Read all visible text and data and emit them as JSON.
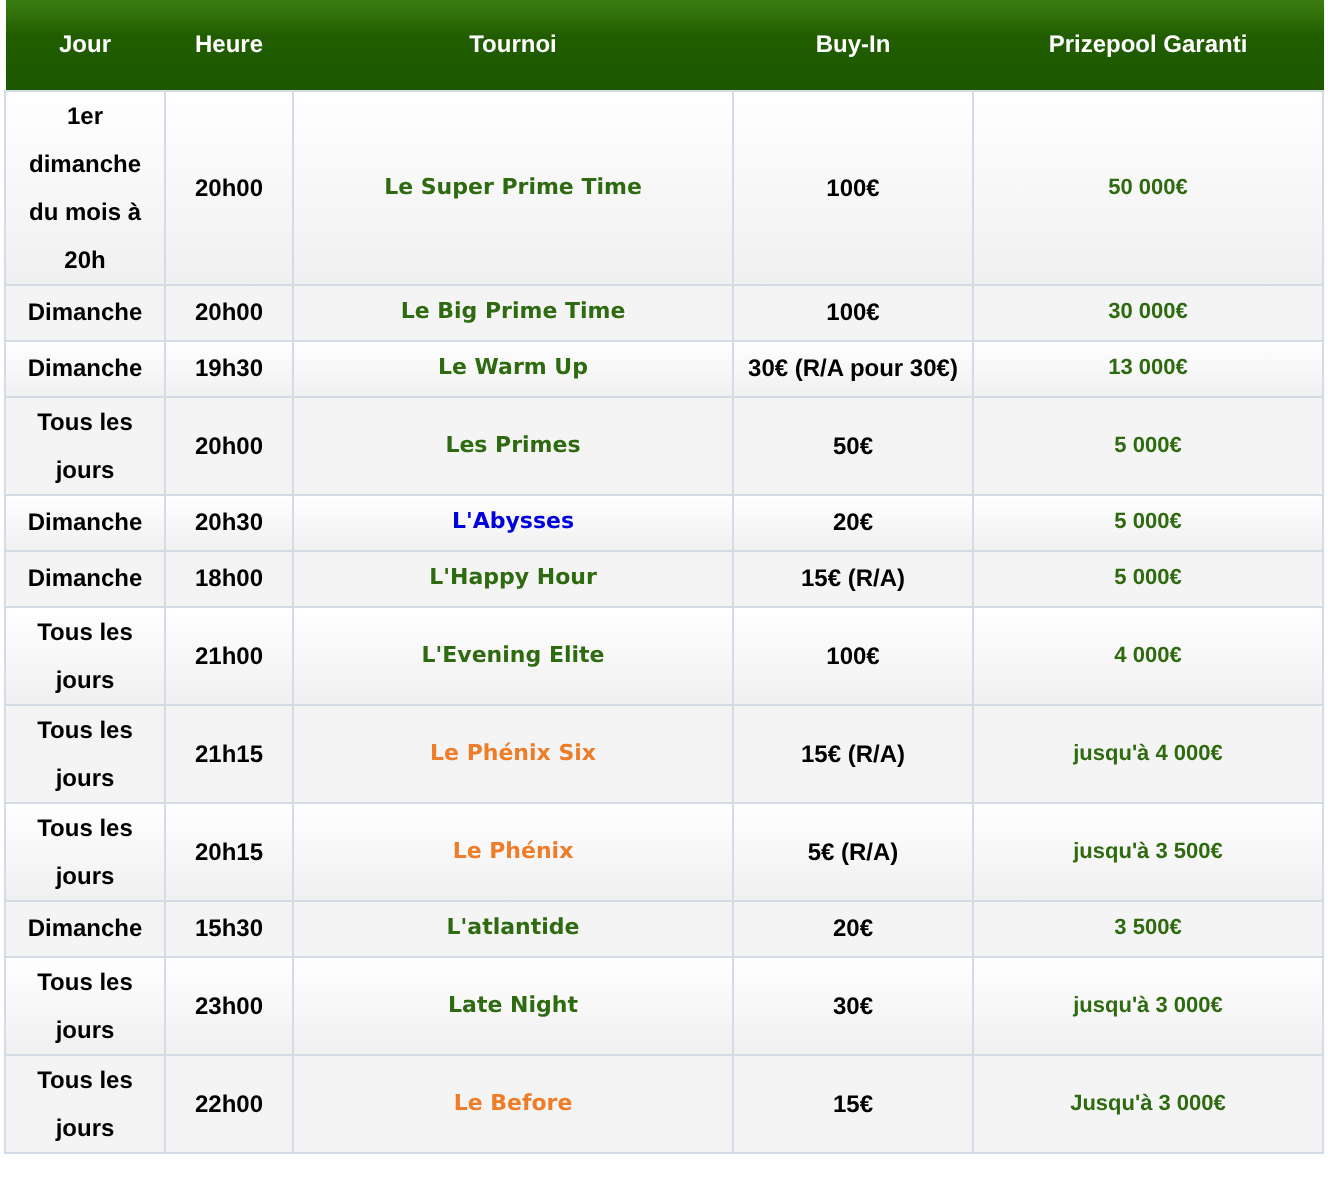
{
  "table": {
    "columns": [
      "Jour",
      "Heure",
      "Tournoi",
      "Buy-In",
      "Prizepool Garanti"
    ],
    "rows": [
      {
        "jour": "1er dimanche du mois à 20h",
        "heure": "20h00",
        "tournoi": "Le Super Prime Time",
        "color": "#2e6a0f",
        "buy_in": "100€",
        "prizepool": "50 000€"
      },
      {
        "jour": "Dimanche",
        "heure": "20h00",
        "tournoi": "Le Big Prime Time",
        "color": "#2e6a0f",
        "buy_in": "100€",
        "prizepool": "30 000€"
      },
      {
        "jour": "Dimanche",
        "heure": "19h30",
        "tournoi": "Le Warm Up",
        "color": "#2e6a0f",
        "buy_in": "30€ (R/A pour 30€)",
        "prizepool": "13 000€"
      },
      {
        "jour": "Tous les jours",
        "heure": "20h00",
        "tournoi": "Les Primes",
        "color": "#2e6a0f",
        "buy_in": "50€",
        "prizepool": "5 000€"
      },
      {
        "jour": "Dimanche",
        "heure": "20h30",
        "tournoi": "L'Abysses",
        "color": "#0000dd",
        "buy_in": "20€",
        "prizepool": "5 000€"
      },
      {
        "jour": "Dimanche",
        "heure": "18h00",
        "tournoi": "L'Happy Hour",
        "color": "#2e6a0f",
        "buy_in": "15€ (R/A)",
        "prizepool": "5 000€"
      },
      {
        "jour": "Tous les jours",
        "heure": "21h00",
        "tournoi": "L'Evening Elite",
        "color": "#2e6a0f",
        "buy_in": "100€",
        "prizepool": "4 000€"
      },
      {
        "jour": "Tous les jours",
        "heure": "21h15",
        "tournoi": "Le Phénix Six",
        "color": "#ee7d2a",
        "buy_in": "15€ (R/A)",
        "prizepool": "jusqu'à 4 000€"
      },
      {
        "jour": "Tous les jours",
        "heure": "20h15",
        "tournoi": "Le Phénix",
        "color": "#ee7d2a",
        "buy_in": "5€ (R/A)",
        "prizepool": "jusqu'à 3 500€"
      },
      {
        "jour": "Dimanche",
        "heure": "15h30",
        "tournoi": "L'atlantide",
        "color": "#2e6a0f",
        "buy_in": "20€",
        "prizepool": "3 500€"
      },
      {
        "jour": "Tous les jours",
        "heure": "23h00",
        "tournoi": "Late Night",
        "color": "#2e6a0f",
        "buy_in": "30€",
        "prizepool": "jusqu'à 3 000€"
      },
      {
        "jour": "Tous les jours",
        "heure": "22h00",
        "tournoi": "Le Before",
        "color": "#ee7d2a",
        "buy_in": "15€",
        "prizepool": "Jusqu'à 3 000€"
      }
    ]
  }
}
